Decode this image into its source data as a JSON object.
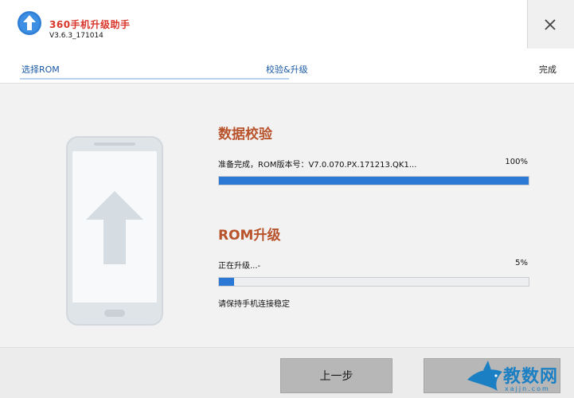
{
  "app": {
    "name": "360手机升级助手",
    "version": "V3.6.3_171014",
    "close_glyph": "✕"
  },
  "steps": [
    {
      "label": "选择ROM"
    },
    {
      "label": "校验&升级"
    },
    {
      "label": "完成"
    }
  ],
  "verify": {
    "title": "数据校验",
    "status": "准备完成，ROM版本号：V7.0.070.PX.171213.QK1...",
    "percent_label": "100%",
    "progress": 1.0
  },
  "upgrade": {
    "title": "ROM升级",
    "status": "正在升级...-",
    "percent_label": "5%",
    "progress": 0.05,
    "note": "请保持手机连接稳定"
  },
  "buttons": {
    "prev_label": "上一步"
  },
  "watermark": {
    "text": "教数网",
    "sub": "xajjn.com"
  },
  "colors": {
    "accent": "#2b79d4",
    "title_red": "#d9352a",
    "section_title": "#b8532c"
  }
}
